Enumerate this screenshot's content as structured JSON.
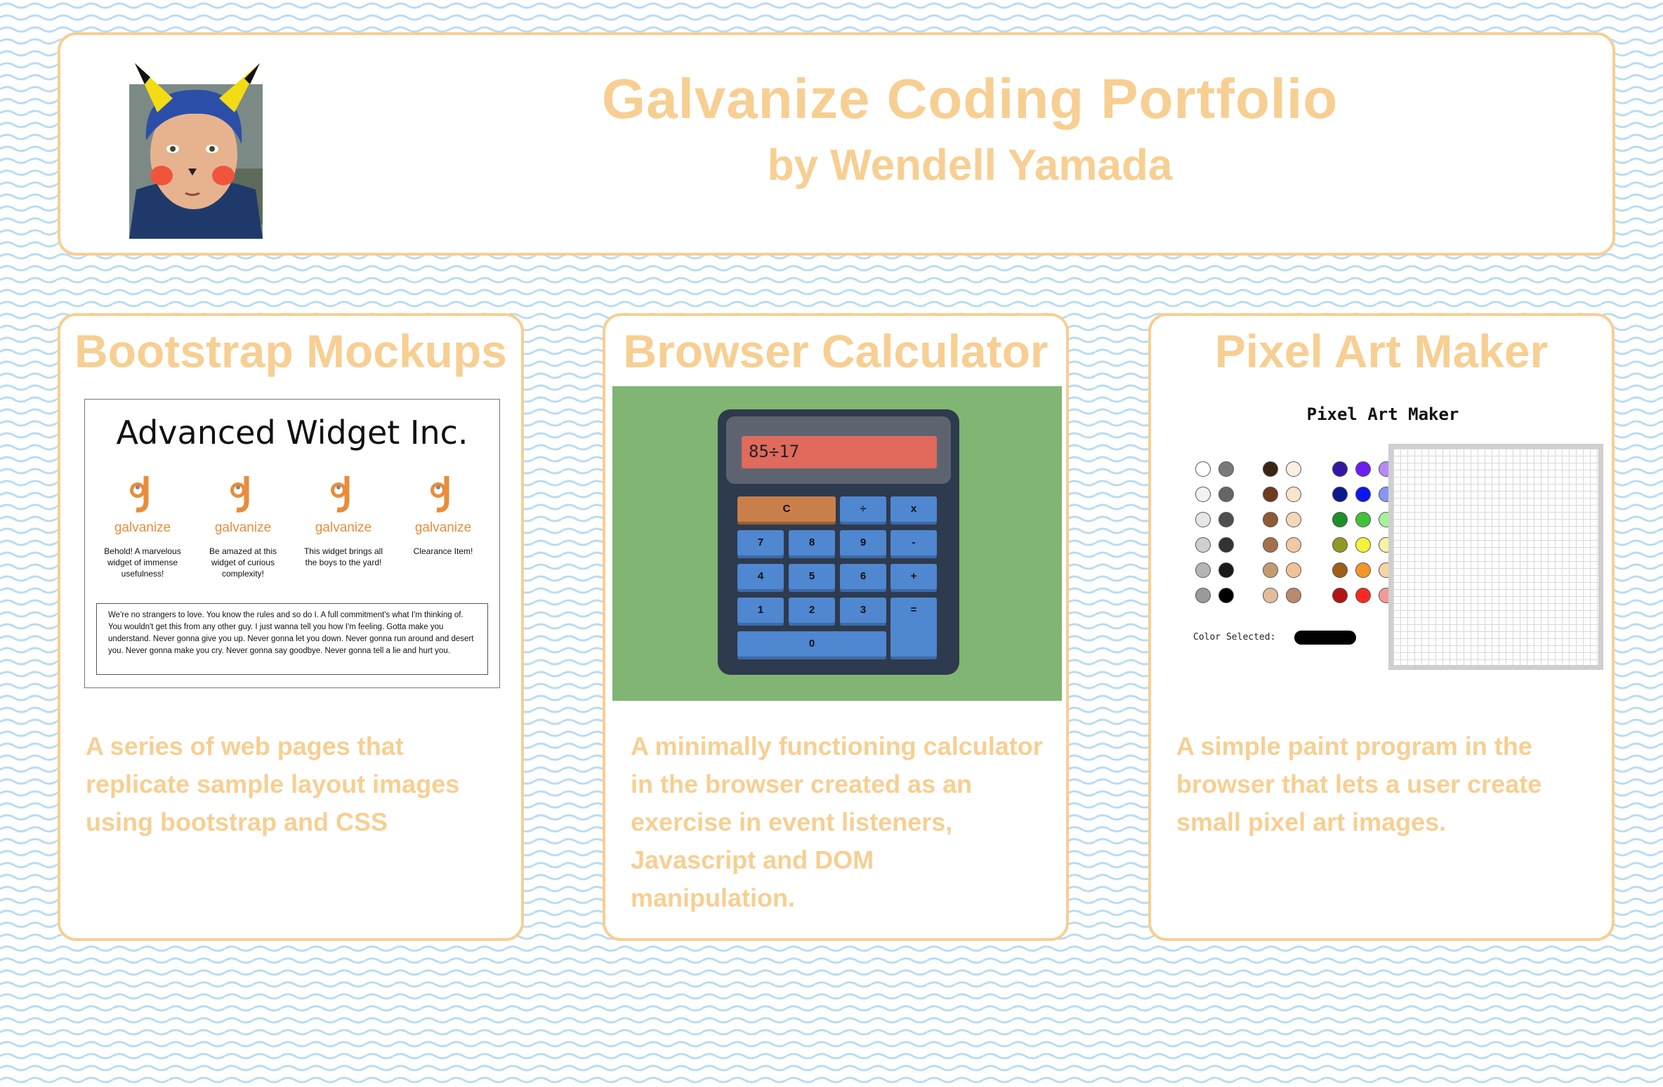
{
  "header": {
    "title": "Galvanize Coding Portfolio",
    "subtitle": "by Wendell Yamada",
    "avatar_icon": "profile-photo-with-pikachu-ears"
  },
  "colors": {
    "accent": "#f7cf92",
    "wave": "#b9dcf3",
    "card_bg": "#ffffff"
  },
  "projects": [
    {
      "title": "Bootstrap Mockups",
      "description": "A series of web pages that replicate sample layout images using bootstrap and CSS",
      "preview": {
        "heading": "Advanced Widget Inc.",
        "brand": "galvanize",
        "widgets": [
          "Behold! A marvelous widget of immense usefulness!",
          "Be amazed at this widget of curious complexity!",
          "This widget brings all the boys to the yard!",
          "Clearance Item!"
        ],
        "paragraph": "We're no strangers to love. You know the rules and so do I. A full commitment's what I'm thinking of. You wouldn't get this from any other guy. I just wanna tell you how I'm feeling. Gotta make you understand. Never gonna give you up. Never gonna let you down. Never gonna run around and desert you. Never gonna make you cry. Never gonna say goodbye. Never gonna tell a lie and hurt you."
      }
    },
    {
      "title": "Browser Calculator",
      "description": "A minimally functioning calculator in the browser created as an exercise in event listeners, Javascript and DOM manipulation.",
      "preview": {
        "display": "85÷17",
        "keys": {
          "clear": "C",
          "divide": "÷",
          "multiply": "x",
          "seven": "7",
          "eight": "8",
          "nine": "9",
          "minus": "-",
          "four": "4",
          "five": "5",
          "six": "6",
          "plus": "+",
          "one": "1",
          "two": "2",
          "three": "3",
          "equals": "=",
          "zero": "0"
        }
      }
    },
    {
      "title": "Pixel Art Maker",
      "description": "A simple paint program in the browser that lets a user create small pixel art images.",
      "preview": {
        "heading": "Pixel Art Maker",
        "color_selected_label": "Color Selected:",
        "selected_color": "#000000",
        "palette": [
          [
            "#ffffff",
            "#7a7a7a",
            "#3a2515",
            "#fbf0e2",
            "#3516a3",
            "#6a1ff0",
            "#b68cf3"
          ],
          [
            "#f2f2f2",
            "#666666",
            "#6e3b21",
            "#fbe3cc",
            "#0b1a8e",
            "#0a17f2",
            "#8795f5"
          ],
          [
            "#e6e6e6",
            "#4e4e4e",
            "#8d5a34",
            "#f6d7b5",
            "#1f8e2a",
            "#42c23a",
            "#a6f29b"
          ],
          [
            "#cfcfcf",
            "#333333",
            "#a3704a",
            "#f0c9a4",
            "#8f9a22",
            "#f6f238",
            "#f7f3a3"
          ],
          [
            "#b5b5b5",
            "#1a1a1a",
            "#c39a72",
            "#f1c297",
            "#9e5f18",
            "#f3972a",
            "#f7d4a4"
          ],
          [
            "#9a9a9a",
            "#000000",
            "#e2bc9b",
            "#b98a6d",
            "#b21515",
            "#f42a24",
            "#f29a99"
          ]
        ]
      }
    }
  ]
}
